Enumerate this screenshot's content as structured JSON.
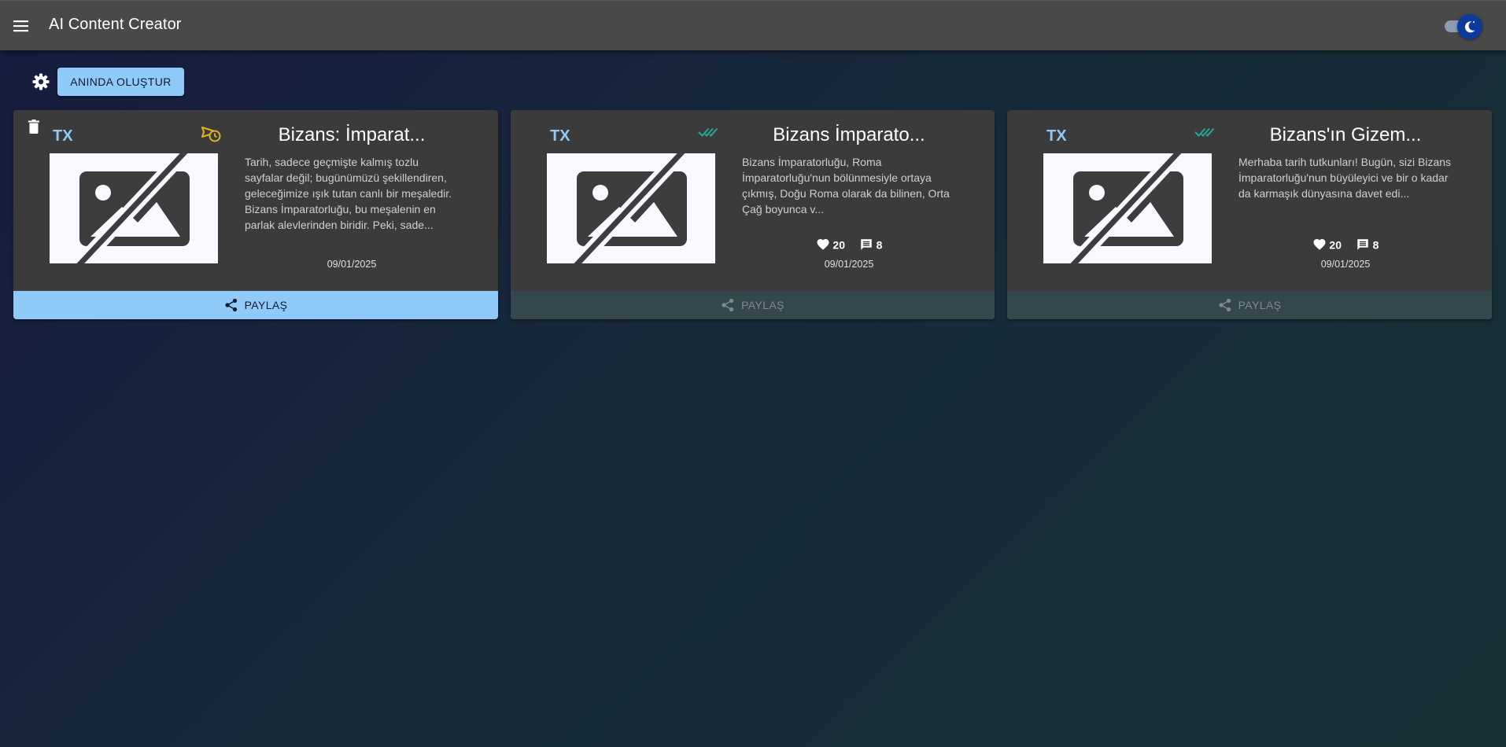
{
  "appbar": {
    "title": "AI Content Creator",
    "menu_icon": "hamburger-menu-icon",
    "theme_toggle_icon": "dark-mode-moon-icon"
  },
  "toolbar": {
    "settings_icon": "gear-icon",
    "create_label": "ANINDA OLUŞTUR"
  },
  "colors": {
    "accent": "#90caf9",
    "card_bg": "#3b3b3b",
    "scheduled": "#e0b31f",
    "published": "#26a69a"
  },
  "cards": [
    {
      "platform": "TX",
      "status": "scheduled",
      "status_icon": "scheduled-send-icon",
      "title": "Bizans: İmparat...",
      "text": "Tarih, sadece geçmişte kalmış tozlu sayfalar değil; bugünümüzü şekillendiren, geleceğimize ışık tutan canlı bir meşaledir. Bizans İmparatorluğu, bu meşalenin en parlak alevlerinden biridir. Peki, sade...",
      "date": "09/01/2025",
      "share_label": "PAYLAŞ"
    },
    {
      "platform": "TX",
      "status": "published",
      "status_icon": "double-check-icon",
      "title": "Bizans İmparato...",
      "text": "Bizans İmparatorluğu, Roma İmparatorluğu'nun bölünmesiyle ortaya çıkmış, Doğu Roma olarak da bilinen, Orta Çağ boyunca v...",
      "likes": "20",
      "comments": "8",
      "date": "09/01/2025",
      "share_label": "PAYLAŞ"
    },
    {
      "platform": "TX",
      "status": "published",
      "status_icon": "double-check-icon",
      "title": "Bizans'ın Gizem...",
      "text": "Merhaba tarih tutkunları! Bugün, sizi Bizans İmparatorluğu'nun büyüleyici ve bir o kadar da karmaşık dünyasına davet edi...",
      "likes": "20",
      "comments": "8",
      "date": "09/01/2025",
      "share_label": "PAYLAŞ"
    }
  ]
}
